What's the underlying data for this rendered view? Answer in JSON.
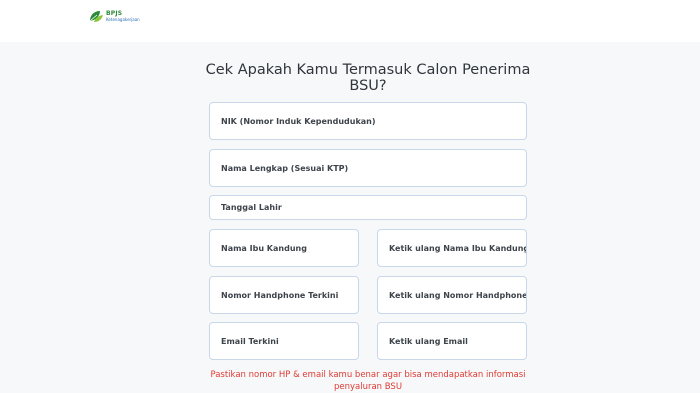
{
  "header": {
    "logo_name": "BPJS",
    "logo_sub": "Ketenagakerjaan",
    "brand_green": "#2d8a3a",
    "brand_blue": "#2d6fb6"
  },
  "form": {
    "title": "Cek Apakah Kamu Termasuk Calon Penerima BSU?",
    "fields": {
      "nik": {
        "placeholder": "NIK (Nomor Induk Kependudukan)",
        "value": ""
      },
      "nama_lengkap": {
        "placeholder": "Nama Lengkap (Sesuai KTP)",
        "value": ""
      },
      "tanggal_lahir": {
        "placeholder": "Tanggal Lahir",
        "value": ""
      },
      "nama_ibu": {
        "placeholder": "Nama Ibu Kandung",
        "value": ""
      },
      "nama_ibu_ulang": {
        "placeholder": "Ketik ulang Nama Ibu Kandung",
        "value": ""
      },
      "hp": {
        "placeholder": "Nomor Handphone Terkini",
        "value": ""
      },
      "hp_ulang": {
        "placeholder": "Ketik ulang Nomor Handphone",
        "value": ""
      },
      "email": {
        "placeholder": "Email Terkini",
        "value": ""
      },
      "email_ulang": {
        "placeholder": "Ketik ulang Email",
        "value": ""
      }
    },
    "note": "Pastikan nomor HP & email kamu benar agar bisa mendapatkan informasi penyaluran BSU",
    "note_color": "#e03b32"
  }
}
